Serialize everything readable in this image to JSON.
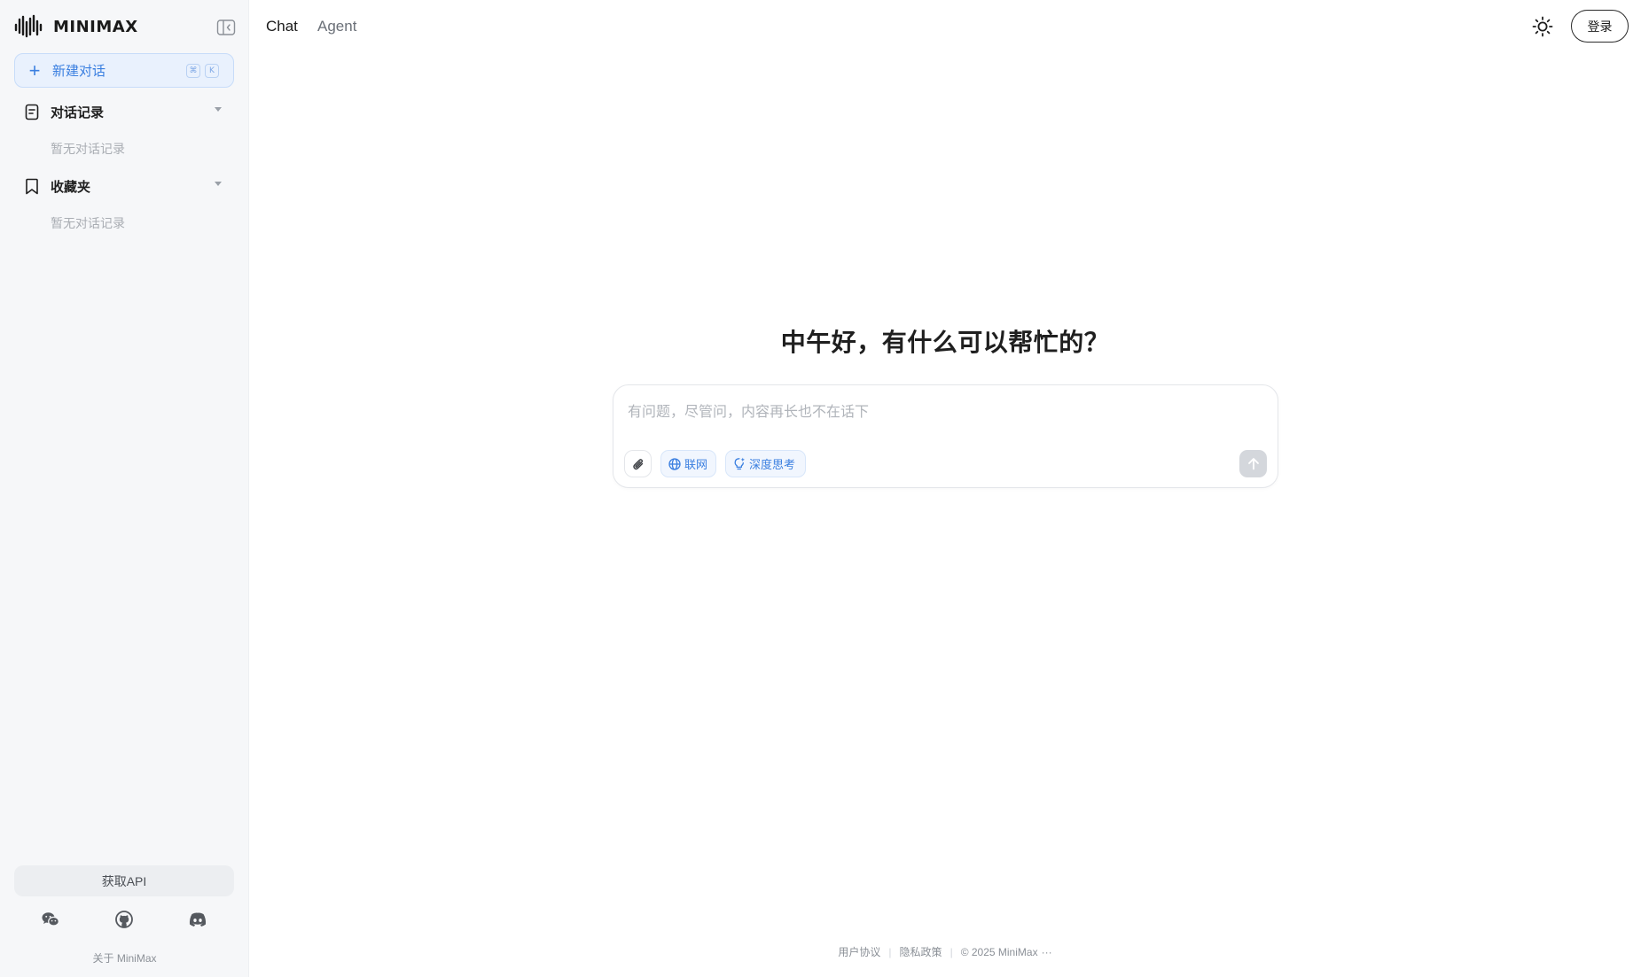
{
  "sidebar": {
    "logo_text": "MINIMAX",
    "new_chat_label": "新建对话",
    "shortcut_keys": [
      "⌘",
      "K"
    ],
    "sections": [
      {
        "label": "对话记录",
        "empty_text": "暂无对话记录"
      },
      {
        "label": "收藏夹",
        "empty_text": "暂无对话记录"
      }
    ],
    "api_button_label": "获取API",
    "social_icons": [
      "wechat-icon",
      "github-icon",
      "discord-icon"
    ],
    "about_label": "关于 MiniMax"
  },
  "header": {
    "tabs": [
      {
        "label": "Chat",
        "active": true
      },
      {
        "label": "Agent",
        "active": false
      }
    ],
    "theme_icon": "sun-icon",
    "login_label": "登录"
  },
  "main": {
    "greeting": "中午好，有什么可以帮忙的？",
    "input": {
      "placeholder": "有问题，尽管问，内容再长也不在话下",
      "value": ""
    },
    "chips": [
      {
        "label": "联网",
        "icon": "globe-icon"
      },
      {
        "label": "深度思考",
        "icon": "sparkle-bulb-icon"
      }
    ],
    "attach_icon": "paperclip-icon",
    "send_icon": "arrow-up-icon"
  },
  "footer": {
    "links": [
      "用户协议",
      "隐私政策",
      "© 2025 MiniMax"
    ],
    "more": "···"
  },
  "colors": {
    "accent": "#3a7fe0",
    "sidebar_bg": "#f6f7f9",
    "send_disabled": "#d4d7dc"
  }
}
